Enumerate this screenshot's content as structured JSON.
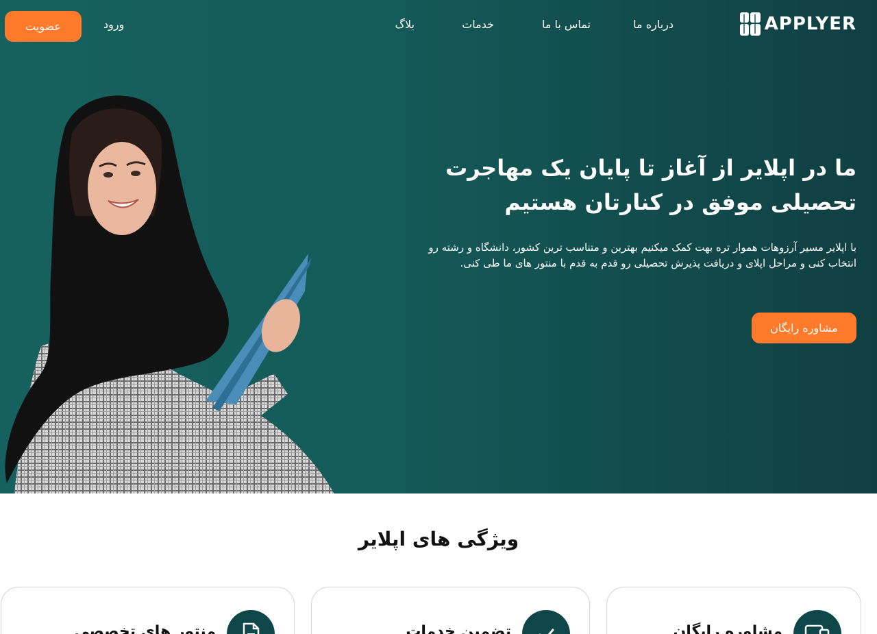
{
  "header": {
    "logo_text": "APPLYER",
    "nav": {
      "about": "درباره ما",
      "contact": "تماس با ما",
      "services": "خدمات",
      "blog": "بلاگ",
      "login": "ورود"
    },
    "signup_label": "عضویت"
  },
  "hero": {
    "title": "ما در اپلایر از آغاز تا پایان یک مهاجرت تحصیلی موفق در کنارتان هستیم",
    "description": "با اپلایر مسیر آرزوهات هموار تره بهت کمک میکنیم بهترین و متناسب ترین کشور، دانشگاه و رشته رو انتخاب کنی و مراحل اپلای و دریافت پذیرش تحصیلی رو قدم به قدم با منتور های ما طی کنی.",
    "cta_label": "مشاوره رایگان"
  },
  "features": {
    "title": "ویژگی های اپلایر",
    "cards": [
      {
        "title": "مشاوره رایگان",
        "icon": "devices-icon"
      },
      {
        "title": "تضمین خدمات",
        "icon": "check-icon"
      },
      {
        "title": "منتور های تخصصی",
        "icon": "document-icon"
      }
    ]
  },
  "colors": {
    "primary": "#0f464a",
    "accent": "#ff7a2a",
    "hero_start": "#16615f",
    "hero_end": "#103f42"
  }
}
